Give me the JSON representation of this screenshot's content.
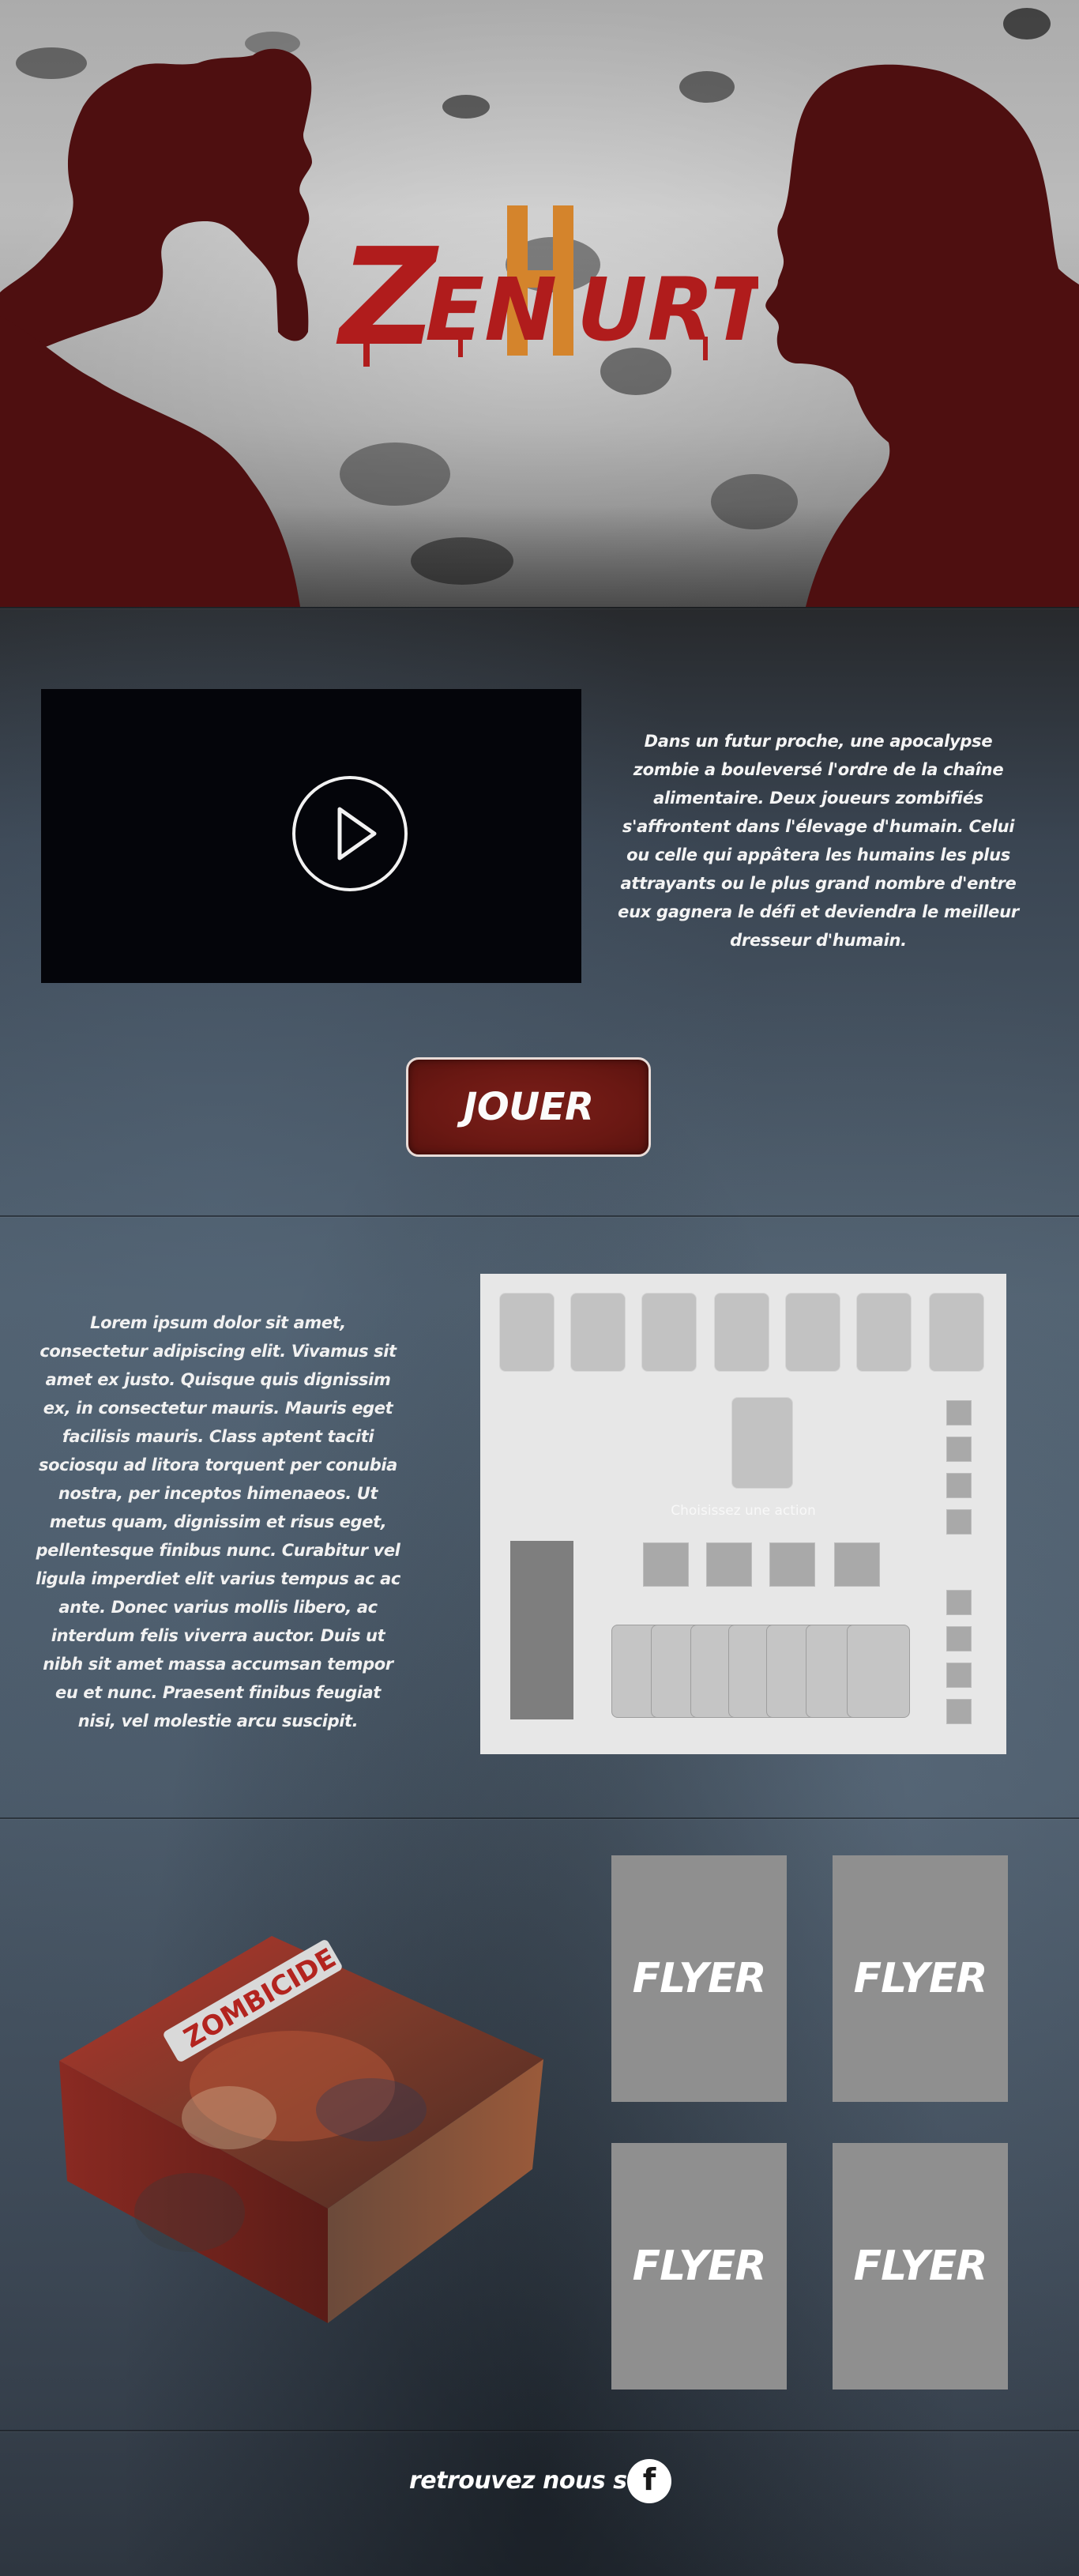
{
  "hero": {
    "logo_text": "ZENHURT"
  },
  "intro": {
    "text": "Dans un futur proche, une apocalypse zombie a bouleversé l'ordre de la chaîne alimentaire. Deux joueurs zombifiés s'affrontent dans l'élevage d'humain. Celui ou celle qui appâtera les humains les plus attrayants ou le plus grand nombre d'entre eux gagnera le défi et deviendra le meilleur dresseur d'humain."
  },
  "play_button": {
    "label": "JOUER"
  },
  "about": {
    "text": "Lorem ipsum dolor sit amet, consectetur adipiscing elit. Vivamus sit amet ex justo. Quisque quis dignissim ex, in consectetur mauris. Mauris eget facilisis mauris. Class aptent taciti sociosqu ad litora torquent per conubia nostra, per inceptos himenaeos. Ut metus quam, dignissim et risus eget, pellentesque finibus nunc. Curabitur vel ligula imperdiet elit varius tempus ac ac ante. Donec varius mollis libero, ac interdum felis viverra auctor. Duis ut nibh sit amet massa accumsan tempor eu et nunc. Praesent finibus feugiat nisi, vel molestie arcu suscipit."
  },
  "board": {
    "status": "Choisissez une action"
  },
  "product": {
    "box_title": "ZOMBICIDE"
  },
  "flyers": [
    {
      "label": "FLYER"
    },
    {
      "label": "FLYER"
    },
    {
      "label": "FLYER"
    },
    {
      "label": "FLYER"
    }
  ],
  "footer": {
    "text": "retrouvez nous sur",
    "social_icon": "facebook-icon",
    "social_glyph": "f"
  },
  "colors": {
    "silhouette": "#4e0f10",
    "button": "#6a1813",
    "logo_red": "#b01c1c",
    "logo_gold": "#d4842c"
  }
}
